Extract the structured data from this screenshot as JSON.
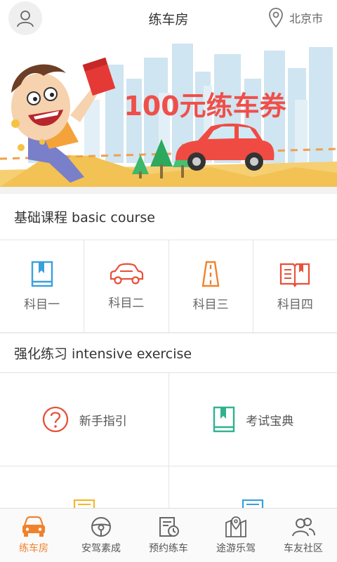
{
  "header": {
    "title": "练车房",
    "city": "北京市"
  },
  "banner": {
    "headline": "100元练车券"
  },
  "basic": {
    "title": "基础课程 basic course",
    "items": [
      {
        "label": "科目一",
        "icon": "book-bookmark-icon"
      },
      {
        "label": "科目二",
        "icon": "car-icon"
      },
      {
        "label": "科目三",
        "icon": "road-icon"
      },
      {
        "label": "科目四",
        "icon": "open-book-icon"
      }
    ]
  },
  "intensive": {
    "title": "强化练习 intensive exercise",
    "items": [
      {
        "label": "新手指引",
        "icon": "question-circle-icon"
      },
      {
        "label": "考试宝典",
        "icon": "book-bookmark-icon"
      }
    ]
  },
  "tabs": [
    {
      "label": "练车房",
      "icon": "car-front-icon",
      "active": true
    },
    {
      "label": "安驾素成",
      "icon": "steering-wheel-icon",
      "active": false
    },
    {
      "label": "预约练车",
      "icon": "schedule-icon",
      "active": false
    },
    {
      "label": "途游乐驾",
      "icon": "map-pin-icon",
      "active": false
    },
    {
      "label": "车友社区",
      "icon": "community-icon",
      "active": false
    }
  ],
  "colors": {
    "accent": "#f0822d",
    "blue": "#3aa0dc",
    "red": "#e8503a",
    "teal": "#2fb38f",
    "yellow": "#f5b62b"
  }
}
